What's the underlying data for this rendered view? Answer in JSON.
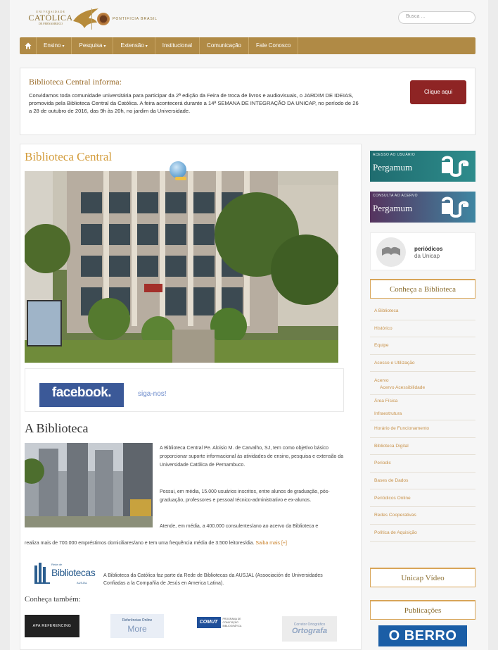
{
  "header": {
    "logo_top": "UNIVERSIDADE",
    "logo_main": "CATÓLICA",
    "logo_sub": "DE PERNAMBUCO",
    "partner_label": "PONTIFICIA BRASIL",
    "search_placeholder": "Busca ..."
  },
  "nav": {
    "home_icon": "home-icon",
    "items": [
      {
        "label": "Ensino",
        "caret": "▾"
      },
      {
        "label": "Pesquisa",
        "caret": "▾"
      },
      {
        "label": "Extensão",
        "caret": "▾"
      },
      {
        "label": "Institucional",
        "caret": ""
      },
      {
        "label": "Comunicação",
        "caret": ""
      },
      {
        "label": "Fale Conosco",
        "caret": ""
      }
    ]
  },
  "notice": {
    "title": "Biblioteca Central informa:",
    "body": "Convidamos toda comunidade universitária para participar da 2ª edição da Feira de troca de livros e audiovisuais, o JARDIM DE IDEIAS, promovida pela Biblioteca Central da Católica. A feira acontecerá durante a 14ª SEMANA DE INTEGRAÇÃO DA UNICAP, no período de 26 a 28 de outubro de 2016, das 9h às 20h, no jardim da Universidade.",
    "button": "Clique aqui"
  },
  "main": {
    "title": "Biblioteca Central",
    "facebook": {
      "logo": "facebook.",
      "sub": "Biblioteca Central da Católica",
      "siga": "siga-nos!"
    },
    "section_title": "A Biblioteca",
    "paragraphs": [
      "A Biblioteca Central Pe. Aloisio M. de Carvalho, SJ, tem como objetivo básico proporcionar suporte informacional às atividades de ensino, pesquisa e extensão da Universidade Católica de Pernambuco.",
      "Possui, em média, 15.000 usuários inscritos, entre alunos de graduação, pós-graduação, professores e pessoal técnico-administrativo e ex-alunos.",
      "Atende, em média, a 400.000 consulentes/ano ao acervo da Biblioteca e"
    ],
    "tail_text": "realiza mais de 700.000 empréstimos domiciliares/ano e tem uma frequência média de 3.500 leitores/dia.",
    "read_more": "Saiba mais [+]",
    "rede": {
      "small": "Rede de",
      "big": "Bibliotecas",
      "ausjal": "AUSJAL",
      "text": "A Biblioteca da Católica faz parte da Rede de Bibliotecas da AUSJAL (Associación de Universidades Confiadas a la Compañía de Jesús en America Latina)."
    },
    "conheca_tambem": "Conheça também:",
    "partners": {
      "apa": "APA REFERENCING",
      "ref_top": "Referências Online",
      "ref_big": "More",
      "comut_box": "COMUT",
      "comut_text": "PROGRAMA DE COMUTAÇÃO BIBLIOGRÁFICA",
      "ort_top": "Corretor Ortográfico",
      "ort_big": "Ortografa"
    }
  },
  "sidebar": {
    "banners": [
      {
        "small": "ACESSO AO USUÁRIO",
        "big": "Pergamum"
      },
      {
        "small": "CONSULTA AO ACERVO",
        "big": "Pergamum"
      }
    ],
    "periodicos": {
      "title": "periódicos",
      "sub": "da Unicap"
    },
    "conheca_head": "Conheça a Biblioteca",
    "links": [
      "A Biblioteca",
      "Histórico",
      "Equipe",
      "Acesso e Utilização",
      "Acervo",
      "Área Física",
      "Infraestrutura",
      "Horário de Funcionamento",
      "Biblioteca Digital",
      "Periodic",
      "Bases de Dados",
      "Periódicos Online",
      "Redes Cooperativas",
      "Política de Aquisição"
    ],
    "acervo_sub": "Acervo Acessibilidade",
    "video_head": "Unicap Vídeo",
    "publicacoes_head": "Publicações",
    "oberro": "O BERRO"
  },
  "colors": {
    "nav": "#b08a45",
    "accent_orange": "#d39c3b",
    "button_red": "#8e2424",
    "facebook_blue": "#3b5998",
    "oberro_blue": "#1b5ea6"
  }
}
